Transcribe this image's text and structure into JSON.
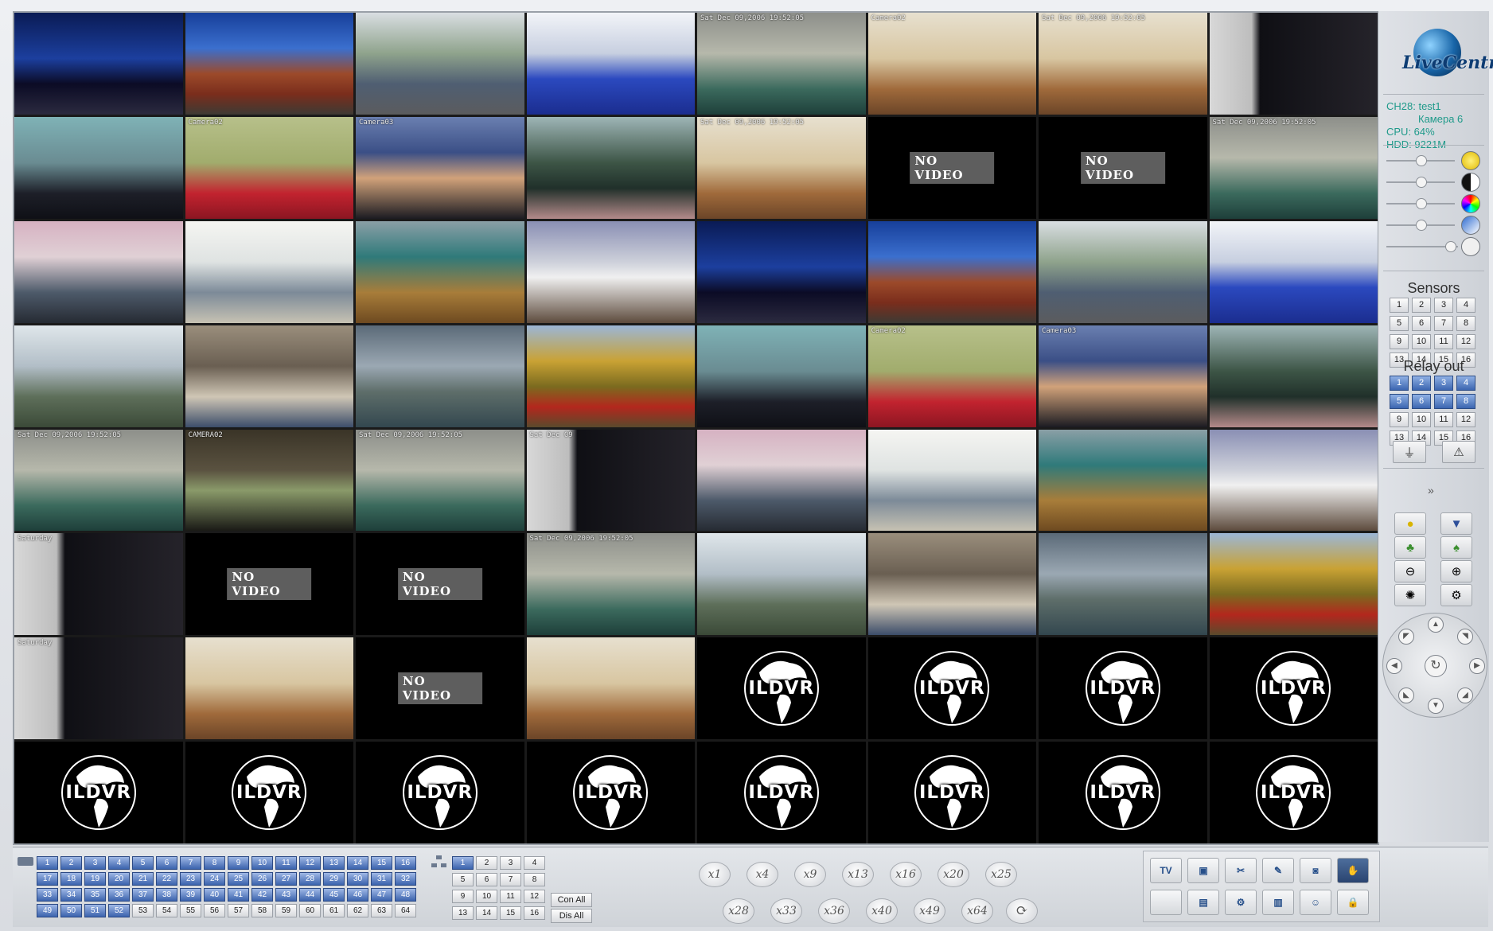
{
  "grid": {
    "tiles": [
      {
        "kind": "video",
        "scene": "city-night",
        "osd": ""
      },
      {
        "kind": "video",
        "scene": "village-house",
        "osd": ""
      },
      {
        "kind": "video",
        "scene": "street-bus",
        "osd": ""
      },
      {
        "kind": "video",
        "scene": "train-interior",
        "osd": ""
      },
      {
        "kind": "video",
        "scene": "office-desk",
        "osd": "Sat Dec 09,2006 19:52:05"
      },
      {
        "kind": "video",
        "scene": "office-room",
        "osd": "Camera02"
      },
      {
        "kind": "video",
        "scene": "office-room",
        "osd": "Sat Dec 09,2006 19:52:05"
      },
      {
        "kind": "video",
        "scene": "building-night",
        "osd": ""
      },
      {
        "kind": "video",
        "scene": "news-anchor-man",
        "osd": ""
      },
      {
        "kind": "video",
        "scene": "news-anchor-woman",
        "osd": "Camera02"
      },
      {
        "kind": "video",
        "scene": "portrait-woman",
        "osd": "Camera03"
      },
      {
        "kind": "video",
        "scene": "woman-outdoor",
        "osd": ""
      },
      {
        "kind": "video",
        "scene": "office-room",
        "osd": "Sat Dec 09,2006 19:52:05"
      },
      {
        "kind": "novideo",
        "label": "NO VIDEO"
      },
      {
        "kind": "novideo",
        "label": "NO VIDEO"
      },
      {
        "kind": "video",
        "scene": "office-desk",
        "osd": "Sat Dec 09,2006 19:52:05"
      },
      {
        "kind": "video",
        "scene": "office-workers",
        "osd": ""
      },
      {
        "kind": "video",
        "scene": "office-cubicle",
        "osd": ""
      },
      {
        "kind": "video",
        "scene": "subway-station",
        "osd": ""
      },
      {
        "kind": "video",
        "scene": "high-speed-train",
        "osd": ""
      },
      {
        "kind": "video",
        "scene": "city-night",
        "osd": ""
      },
      {
        "kind": "video",
        "scene": "village-house",
        "osd": ""
      },
      {
        "kind": "video",
        "scene": "street-bus",
        "osd": ""
      },
      {
        "kind": "video",
        "scene": "train-interior",
        "osd": ""
      },
      {
        "kind": "video",
        "scene": "office-corridor",
        "osd": ""
      },
      {
        "kind": "video",
        "scene": "desk-top-view",
        "osd": ""
      },
      {
        "kind": "video",
        "scene": "harbor",
        "osd": ""
      },
      {
        "kind": "video",
        "scene": "red-train-autumn",
        "osd": ""
      },
      {
        "kind": "video",
        "scene": "news-anchor-man",
        "osd": ""
      },
      {
        "kind": "video",
        "scene": "news-anchor-woman",
        "osd": "Camera02"
      },
      {
        "kind": "video",
        "scene": "portrait-woman",
        "osd": "Camera03"
      },
      {
        "kind": "video",
        "scene": "woman-outdoor",
        "osd": ""
      },
      {
        "kind": "video",
        "scene": "office-desk",
        "osd": "Sat Dec 09,2006 19:52:05",
        "selected": true
      },
      {
        "kind": "video",
        "scene": "overhead-room",
        "osd": "CAMERA02"
      },
      {
        "kind": "video",
        "scene": "office-desk",
        "osd": "Sat Dec 09,2006 19:52:05"
      },
      {
        "kind": "video",
        "scene": "building-night",
        "osd": "Sat Dec 09"
      },
      {
        "kind": "video",
        "scene": "office-workers",
        "osd": ""
      },
      {
        "kind": "video",
        "scene": "office-cubicle",
        "osd": ""
      },
      {
        "kind": "video",
        "scene": "subway-station",
        "osd": ""
      },
      {
        "kind": "video",
        "scene": "high-speed-train",
        "osd": ""
      },
      {
        "kind": "video",
        "scene": "building-night",
        "osd": "Saturday"
      },
      {
        "kind": "novideo",
        "label": "NO VIDEO"
      },
      {
        "kind": "novideo",
        "label": "NO VIDEO"
      },
      {
        "kind": "video",
        "scene": "office-desk",
        "osd": "Sat Dec 09,2006 19:52:05"
      },
      {
        "kind": "video",
        "scene": "office-corridor",
        "osd": ""
      },
      {
        "kind": "video",
        "scene": "desk-top-view",
        "osd": ""
      },
      {
        "kind": "video",
        "scene": "harbor",
        "osd": ""
      },
      {
        "kind": "video",
        "scene": "red-train-autumn",
        "osd": ""
      },
      {
        "kind": "video",
        "scene": "building-night",
        "osd": "Saturday"
      },
      {
        "kind": "video",
        "scene": "office-room",
        "osd": ""
      },
      {
        "kind": "novideo",
        "label": "NO VIDEO"
      },
      {
        "kind": "video",
        "scene": "office-room",
        "osd": ""
      },
      {
        "kind": "logo",
        "label": "ILDVR"
      },
      {
        "kind": "logo",
        "label": "ILDVR"
      },
      {
        "kind": "logo",
        "label": "ILDVR"
      },
      {
        "kind": "logo",
        "label": "ILDVR"
      },
      {
        "kind": "logo",
        "label": "ILDVR"
      },
      {
        "kind": "logo",
        "label": "ILDVR"
      },
      {
        "kind": "logo",
        "label": "ILDVR"
      },
      {
        "kind": "logo",
        "label": "ILDVR"
      },
      {
        "kind": "logo",
        "label": "ILDVR"
      },
      {
        "kind": "logo",
        "label": "ILDVR"
      },
      {
        "kind": "logo",
        "label": "ILDVR"
      },
      {
        "kind": "logo",
        "label": "ILDVR"
      }
    ]
  },
  "side": {
    "brand": "LiveCentre",
    "status": {
      "channel": "CH28: test1",
      "camera": "Камера 6",
      "cpu": "CPU: 64%",
      "hdd": "HDD: 9221M"
    },
    "image_controls": [
      {
        "icon": "brightness-icon",
        "level": 0.5
      },
      {
        "icon": "contrast-icon",
        "level": 0.5
      },
      {
        "icon": "saturation-icon",
        "level": 0.5
      },
      {
        "icon": "hue-icon",
        "level": 0.5
      },
      {
        "icon": "volume-icon",
        "level": 0.95
      }
    ],
    "sensors_title": "Sensors",
    "sensors": [
      "1",
      "2",
      "3",
      "4",
      "5",
      "6",
      "7",
      "8",
      "9",
      "10",
      "11",
      "12",
      "13",
      "14",
      "15",
      "16"
    ],
    "relay_title": "Relay out",
    "relays": [
      {
        "label": "1",
        "on": true
      },
      {
        "label": "2",
        "on": true
      },
      {
        "label": "3",
        "on": true
      },
      {
        "label": "4",
        "on": true
      },
      {
        "label": "5",
        "on": true
      },
      {
        "label": "6",
        "on": true
      },
      {
        "label": "7",
        "on": true
      },
      {
        "label": "8",
        "on": true
      },
      {
        "label": "9",
        "on": false
      },
      {
        "label": "10",
        "on": false
      },
      {
        "label": "11",
        "on": false
      },
      {
        "label": "12",
        "on": false
      },
      {
        "label": "13",
        "on": false
      },
      {
        "label": "14",
        "on": false
      },
      {
        "label": "15",
        "on": false
      },
      {
        "label": "16",
        "on": false
      }
    ],
    "collapse_glyph": "»"
  },
  "bottom": {
    "channels_on_count": 52,
    "channels": [
      "1",
      "2",
      "3",
      "4",
      "5",
      "6",
      "7",
      "8",
      "9",
      "10",
      "11",
      "12",
      "13",
      "14",
      "15",
      "16",
      "17",
      "18",
      "19",
      "20",
      "21",
      "22",
      "23",
      "24",
      "25",
      "26",
      "27",
      "28",
      "29",
      "30",
      "31",
      "32",
      "33",
      "34",
      "35",
      "36",
      "37",
      "38",
      "39",
      "40",
      "41",
      "42",
      "43",
      "44",
      "45",
      "46",
      "47",
      "48",
      "49",
      "50",
      "51",
      "52",
      "53",
      "54",
      "55",
      "56",
      "57",
      "58",
      "59",
      "60",
      "61",
      "62",
      "63",
      "64"
    ],
    "groups": [
      "1",
      "2",
      "3",
      "4",
      "5",
      "6",
      "7",
      "8",
      "9",
      "10",
      "11",
      "12",
      "13",
      "14",
      "15",
      "16"
    ],
    "con_all": "Con All",
    "dis_all": "Dis All",
    "layouts_row1": [
      "x1",
      "x4",
      "x9",
      "x13",
      "x16",
      "x20",
      "x25"
    ],
    "layouts_row2": [
      "x28",
      "x33",
      "x36",
      "x40",
      "x49",
      "x64"
    ],
    "tools_row1": [
      "TV",
      "monitor",
      "tools",
      "edit",
      "camera",
      "hand"
    ],
    "tools_row2": [
      "blank",
      "display",
      "settings",
      "book",
      "user",
      "lock"
    ]
  }
}
